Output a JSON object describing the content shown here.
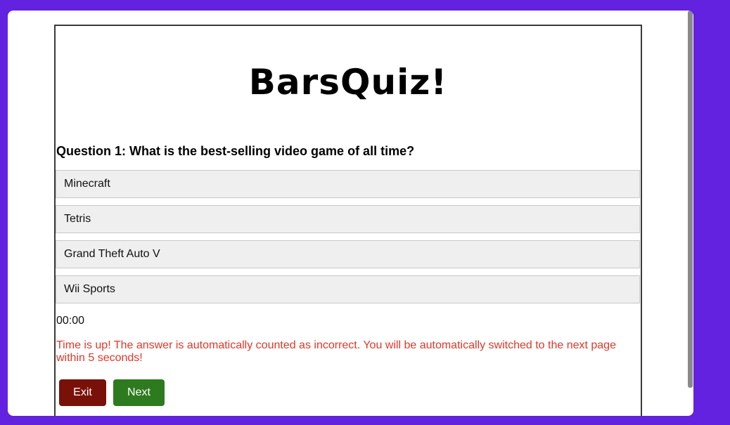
{
  "app": {
    "logo_text": "BarsQuiz!"
  },
  "question": {
    "text": "Question 1: What is the best-selling video game of all time?"
  },
  "answers": [
    {
      "label": "Minecraft"
    },
    {
      "label": "Tetris"
    },
    {
      "label": "Grand Theft Auto V"
    },
    {
      "label": "Wii Sports"
    }
  ],
  "timer": {
    "value": "00:00"
  },
  "status": {
    "message": "Time is up! The answer is automatically counted as incorrect. You will be automatically switched to the next page within 5 seconds!",
    "color": "#e0382a"
  },
  "buttons": {
    "exit_label": "Exit",
    "next_label": "Next",
    "exit_color": "#7a1108",
    "next_color": "#2e7a1e"
  },
  "theme": {
    "background": "#6322e0"
  }
}
